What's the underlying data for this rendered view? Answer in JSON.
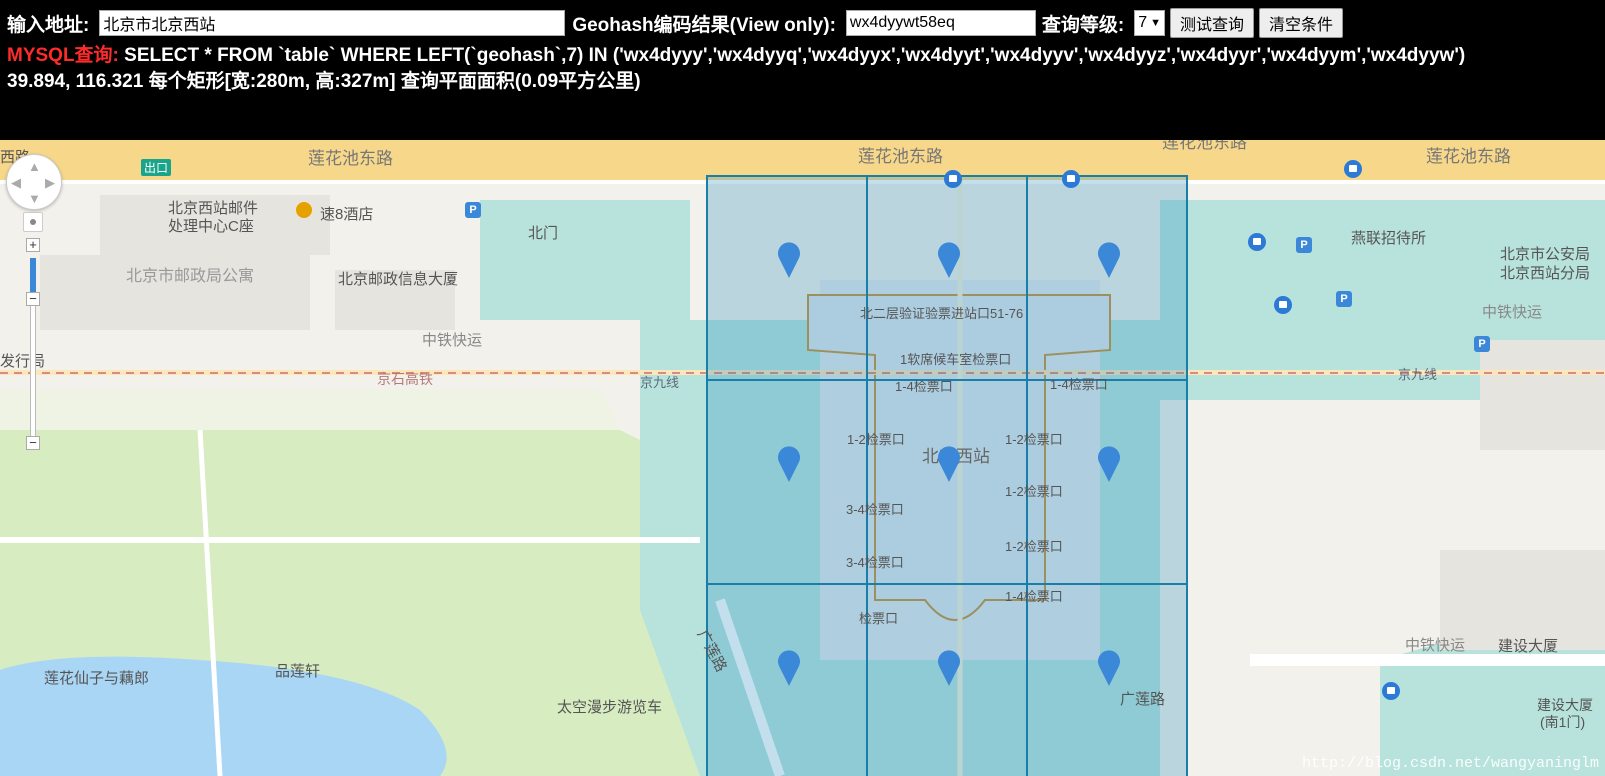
{
  "query_bar": {
    "address_label": "输入地址:",
    "address_value": "北京市北京西站",
    "geohash_label": "Geohash编码结果(View only):",
    "geohash_value": "wx4dyywt58eq",
    "level_label": "查询等级:",
    "level_value": "7",
    "test_button": "测试查询",
    "clear_button": "清空条件"
  },
  "sql": {
    "prefix": "MYSQL查询:",
    "query": " SELECT * FROM `table` WHERE LEFT(`geohash`,7) IN ('wx4dyyy','wx4dyyq','wx4dyyx','wx4dyyt','wx4dyyv','wx4dyyz','wx4dyyr','wx4dyym','wx4dyyw')"
  },
  "info": {
    "line": "39.894, 116.321 每个矩形[宽:280m, 高:327m]  查询平面面积(0.09平方公里)"
  },
  "map": {
    "colors": {
      "land": "#f3f1eb",
      "green": "#d7ecc0",
      "water": "#a9d6f5",
      "teal": "#b8e3dd",
      "road": "#f7d88a",
      "grid_fill": "rgba(40,140,190,0.28)",
      "grid_border": "#1a7fa8",
      "marker": "#3b88d8"
    },
    "labels": {
      "road_lianhuachi_w": "莲花池东路",
      "road_lianhuachi_c": "莲花池东路",
      "road_lianhuachi_e": "莲花池东路",
      "road_lianhuachi_top": "莲花池东路",
      "xilu": "西路",
      "exit": "出口",
      "mail_center_1": "北京西站邮件",
      "mail_center_2": "处理中心C座",
      "hotel8": "速8酒店",
      "north_gate": "北门",
      "apartment": "北京市邮政局公寓",
      "post_building": "北京邮政信息大厦",
      "zhongtie_w": "中铁快运",
      "faxinghang": "发行局",
      "jingshi": "京石高铁",
      "jingjiu_w": "京九线",
      "jingjiu_e": "京九线",
      "yanlian": "燕联招待所",
      "police_1": "北京市公安局",
      "police_2": "北京西站分局",
      "zhongtie_e": "中铁快运",
      "zhongtie_se": "中铁快运",
      "jianshe": "建设大厦",
      "jianshe_s1": "建设大厦",
      "jianshe_s2": "(南1门)",
      "guanglian_w": "广莲路",
      "guanglian_e": "广莲路",
      "lotus_fairy": "莲花仙子与藕郎",
      "pinlianxuan": "品莲轩",
      "space_walk": "太空漫步游览车",
      "station_name": "北京西站",
      "station_a": "北二层验证验票进站口51-76",
      "station_b": "1软席候车室检票口",
      "station_c1": "1-4检票口",
      "station_c2": "1-4检票口",
      "station_d1": "1-2检票口",
      "station_d2": "1-2检票口",
      "station_e": "1-2检票口",
      "station_f1": "3-4检票口",
      "station_f2": "1-2检票口",
      "station_g": "3-4检票口",
      "station_h": "1-4检票口",
      "station_i": "检票口"
    },
    "watermark": "http://blog.csdn.net/wangyaninglm"
  }
}
